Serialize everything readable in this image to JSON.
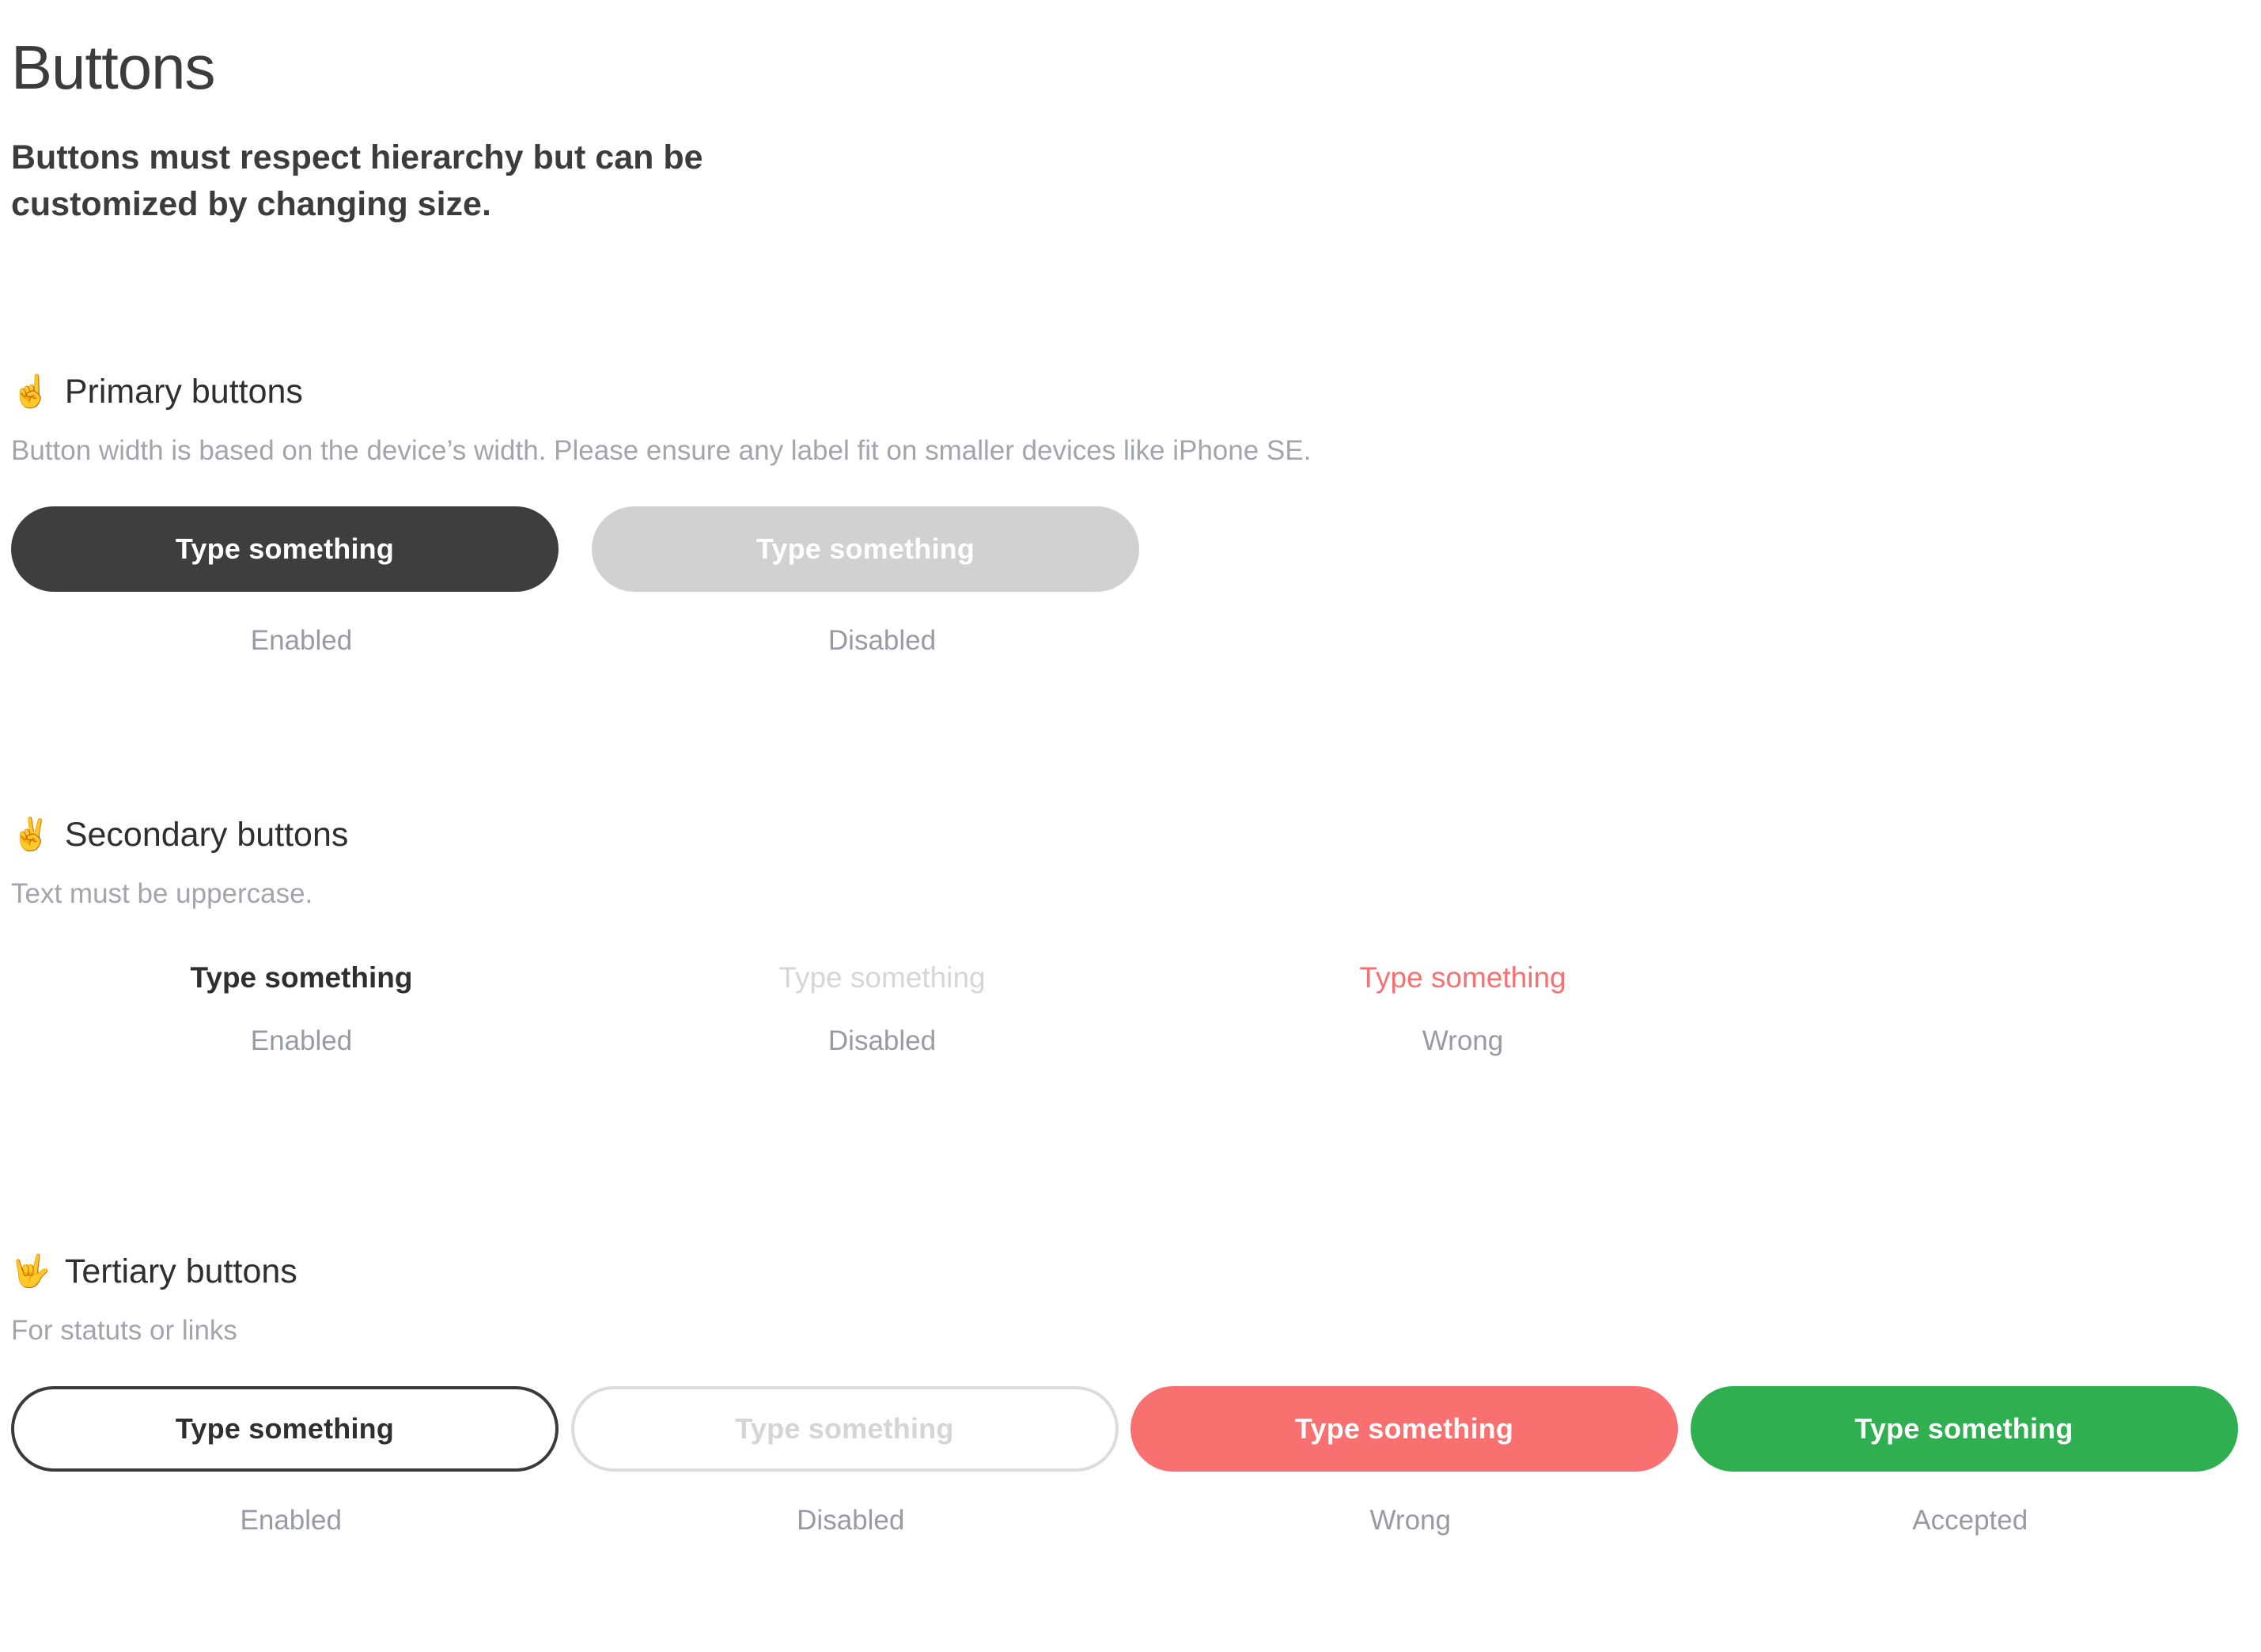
{
  "page": {
    "title": "Buttons",
    "subtitle": "Buttons must respect hierarchy but can be customized by changing size.",
    "background_color": "#ffffff"
  },
  "colors": {
    "primary_enabled_bg": "#3e3e3e",
    "primary_disabled_bg": "#d1d1d1",
    "outline_enabled_border": "#3a3a3a",
    "outline_disabled_border": "#dcdcdc",
    "wrong": "#f97070",
    "accepted": "#2faf4f",
    "caption_text": "#9a9aa4",
    "description_text": "#a4a4ac",
    "heading_text": "#2f2f2f"
  },
  "sections": [
    {
      "id": "primary",
      "emoji": "☝️",
      "emoji_name": "index-pointing-up-emoji",
      "heading": "Primary buttons",
      "description": "Button width is based on the device’s width. Please ensure any label fit on smaller devices like iPhone SE.",
      "buttons": [
        {
          "label": "Type something",
          "caption": "Enabled",
          "state": "enabled"
        },
        {
          "label": "Type something",
          "caption": "Disabled",
          "state": "disabled"
        }
      ]
    },
    {
      "id": "secondary",
      "emoji": "✌️",
      "emoji_name": "victory-hand-emoji",
      "heading": "Secondary buttons",
      "description": "Text must be uppercase.",
      "buttons": [
        {
          "label": "Type something",
          "caption": "Enabled",
          "state": "enabled"
        },
        {
          "label": "Type something",
          "caption": "Disabled",
          "state": "disabled"
        },
        {
          "label": "Type something",
          "caption": "Wrong",
          "state": "wrong"
        }
      ]
    },
    {
      "id": "tertiary",
      "emoji": "🤟",
      "emoji_name": "love-you-gesture-emoji",
      "heading": "Tertiary buttons",
      "description": "For statuts or links",
      "buttons": [
        {
          "label": "Type something",
          "caption": "Enabled",
          "state": "enabled"
        },
        {
          "label": "Type something",
          "caption": "Disabled",
          "state": "disabled"
        },
        {
          "label": "Type something",
          "caption": "Wrong",
          "state": "wrong"
        },
        {
          "label": "Type something",
          "caption": "Accepted",
          "state": "accepted"
        }
      ]
    }
  ]
}
